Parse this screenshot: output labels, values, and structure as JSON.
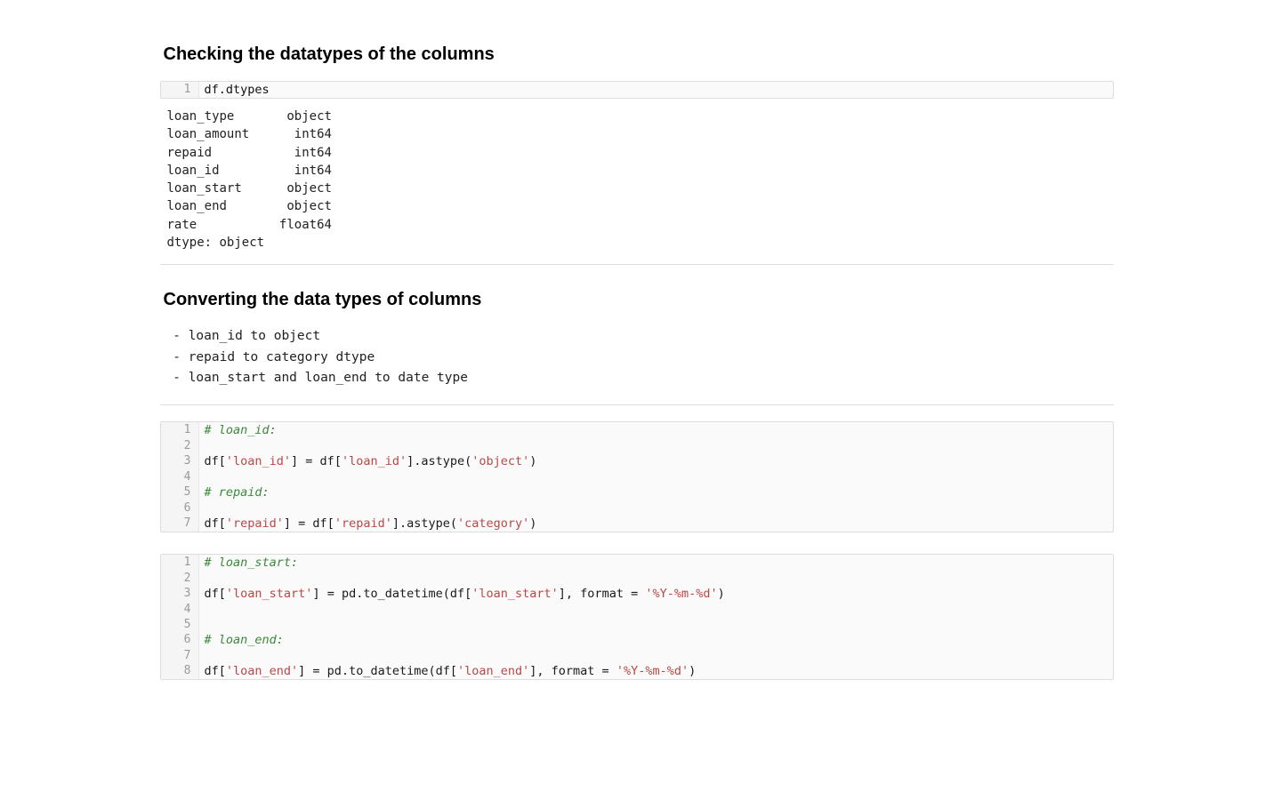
{
  "section1": {
    "title": "Checking the datatypes of the columns",
    "code": {
      "lines": [
        "df.dtypes"
      ]
    },
    "output": "loan_type       object\nloan_amount      int64\nrepaid           int64\nloan_id          int64\nloan_start      object\nloan_end        object\nrate           float64\ndtype: object"
  },
  "section2": {
    "title": "Converting the data types of columns",
    "bullets": [
      "loan_id to object",
      "repaid to category dtype",
      "loan_start and loan_end to date type"
    ],
    "codeA": {
      "lines": [
        {
          "type": "comment",
          "text": "# loan_id:"
        },
        {
          "type": "blank",
          "text": ""
        },
        {
          "type": "code",
          "segments": [
            {
              "t": "name",
              "v": "df["
            },
            {
              "t": "str",
              "v": "'loan_id'"
            },
            {
              "t": "name",
              "v": "] = df["
            },
            {
              "t": "str",
              "v": "'loan_id'"
            },
            {
              "t": "name",
              "v": "].astype("
            },
            {
              "t": "str",
              "v": "'object'"
            },
            {
              "t": "name",
              "v": ")"
            }
          ]
        },
        {
          "type": "blank",
          "text": ""
        },
        {
          "type": "comment",
          "text": "# repaid:"
        },
        {
          "type": "blank",
          "text": ""
        },
        {
          "type": "code",
          "segments": [
            {
              "t": "name",
              "v": "df["
            },
            {
              "t": "str",
              "v": "'repaid'"
            },
            {
              "t": "name",
              "v": "] = df["
            },
            {
              "t": "str",
              "v": "'repaid'"
            },
            {
              "t": "name",
              "v": "].astype("
            },
            {
              "t": "str",
              "v": "'category'"
            },
            {
              "t": "name",
              "v": ")"
            }
          ]
        }
      ]
    },
    "codeB": {
      "lines": [
        {
          "type": "comment",
          "text": "# loan_start:"
        },
        {
          "type": "blank",
          "text": ""
        },
        {
          "type": "code",
          "segments": [
            {
              "t": "name",
              "v": "df["
            },
            {
              "t": "str",
              "v": "'loan_start'"
            },
            {
              "t": "name",
              "v": "] = pd.to_datetime(df["
            },
            {
              "t": "str",
              "v": "'loan_start'"
            },
            {
              "t": "name",
              "v": "], format = "
            },
            {
              "t": "str",
              "v": "'%Y-%m-%d'"
            },
            {
              "t": "name",
              "v": ")"
            }
          ]
        },
        {
          "type": "blank",
          "text": ""
        },
        {
          "type": "blank",
          "text": ""
        },
        {
          "type": "comment",
          "text": "# loan_end:"
        },
        {
          "type": "blank",
          "text": ""
        },
        {
          "type": "code",
          "segments": [
            {
              "t": "name",
              "v": "df["
            },
            {
              "t": "str",
              "v": "'loan_end'"
            },
            {
              "t": "name",
              "v": "] = pd.to_datetime(df["
            },
            {
              "t": "str",
              "v": "'loan_end'"
            },
            {
              "t": "name",
              "v": "], format = "
            },
            {
              "t": "str",
              "v": "'%Y-%m-%d'"
            },
            {
              "t": "name",
              "v": ")"
            }
          ]
        }
      ]
    }
  }
}
